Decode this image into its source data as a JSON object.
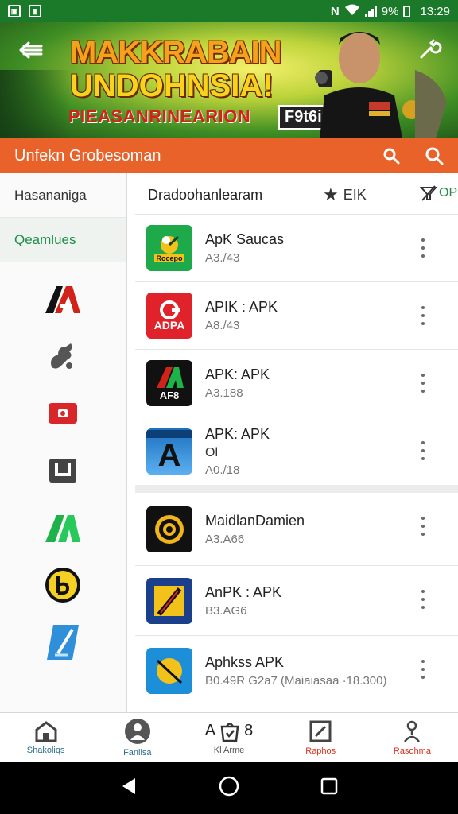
{
  "status_bar": {
    "battery": "9%",
    "time": "13:29"
  },
  "banner": {
    "title_line_1": "MAKKRABAIN",
    "title_line_2": "UNDOHNSIA!",
    "title_line_3": "PIEASANRINEARION",
    "tag": "F9t6i9d"
  },
  "toolbar": {
    "title": "Unfekn Grobesoman"
  },
  "sidebar": {
    "items": [
      {
        "label": "Hasananiga"
      },
      {
        "label": "Qeamlues"
      }
    ],
    "icons": [
      "a-logo-icon",
      "puzzle-icon",
      "youtube-icon",
      "square-icon",
      "green-a-icon",
      "b-circle-icon",
      "blue-tile-icon"
    ]
  },
  "list_header": {
    "title": "Dradoohanlearam",
    "rating_label": "EIK",
    "filter_label": "OP"
  },
  "apps": [
    {
      "name": "ApK Saucas",
      "sub": "A3./43",
      "extra": "",
      "icon_text": "Rocepo"
    },
    {
      "name": "APIK : APK",
      "sub": "A8./43",
      "extra": "",
      "icon_text": "ADPA"
    },
    {
      "name": "APK: APK",
      "sub": "A3.188",
      "extra": "",
      "icon_text": "AF8"
    },
    {
      "name": "APK: APK",
      "sub": "A0./18",
      "extra": "Ol",
      "icon_text": "A"
    },
    {
      "name": "MaidlanDamien",
      "sub": "A3.A66",
      "extra": "",
      "icon_text": ""
    },
    {
      "name": "AnPK : APK",
      "sub": "B3.AG6",
      "extra": "",
      "icon_text": ""
    },
    {
      "name": "Aphkss APK",
      "sub": "B0.49R G2a7 (Maiaiasaa ·18.300)",
      "extra": "",
      "icon_text": ""
    }
  ],
  "bottom_nav": [
    {
      "label": "Shakoliqs"
    },
    {
      "label": "Fanlisa"
    },
    {
      "label": "Kl Arme"
    },
    {
      "label": "Raphos"
    },
    {
      "label": "Rasohma"
    }
  ],
  "bottom_nav_center_text": "A",
  "bottom_nav_center_num": "8"
}
